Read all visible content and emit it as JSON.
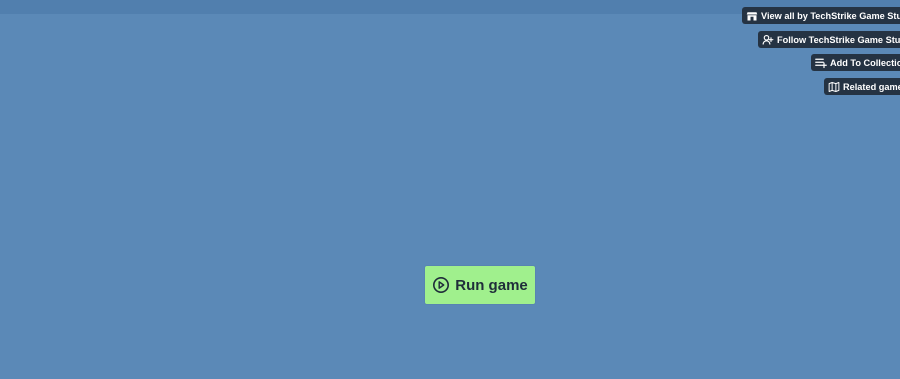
{
  "top_bar": {},
  "side_actions": {
    "view_all_label": "View all by TechStrike Game Studio",
    "view_all_icon": "storefront-icon",
    "follow_label": "Follow TechStrike Game Studio",
    "follow_icon": "follow-user-icon",
    "collection_label": "Add To Collection",
    "collection_icon": "add-collection-icon",
    "related_label": "Related games",
    "related_icon": "map-icon"
  },
  "main": {
    "run_game_label": "Run game",
    "run_game_icon": "play-circle-icon"
  },
  "colors": {
    "background": "#5b89b7",
    "top_bar": "#517fae",
    "action_button": "#253343",
    "run_button": "#a0f08d",
    "run_text": "#1f2d3a"
  }
}
